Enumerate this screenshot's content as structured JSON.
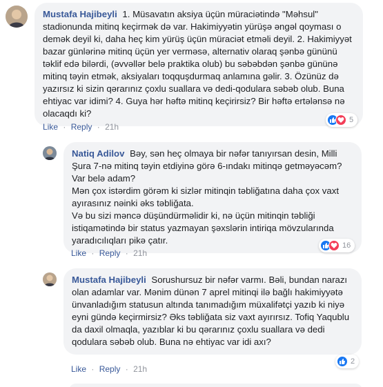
{
  "comments": [
    {
      "author": "Mustafa Hajibeyli",
      "text": "1. Müsavatın aksiya üçün müraciətində \"Məhsul\" stadionunda mitinq keçirmək də var. Hakimiyyətin yürüşə əngəl qoyması o demək deyil ki, daha heç kim yürüş üçün müraciət etməli deyil. 2. Hakimiyyət bazar günlərinə mitinq üçün yer verməsə, alternativ olaraq şənbə gününü təklif edə bilərdi, (əvvəllər belə praktika olub) bu səbəbdən şənbə gününə mitinq təyin etmək, aksiyaları toqquşdurmaq anlamına gəlir. 3. Özünüz də yazırsız ki sizin qərarınız çoxlu suallara və dedi-qodulara səbəb olub. Buna ehtiyac var idimi? 4. Guya hər həftə mitinq keçirirsiz? Bir həftə ertələnsə nə olacaqdı ki?",
      "like": "Like",
      "reply": "Reply",
      "time": "21h",
      "reaction_count": "5"
    },
    {
      "author": "Natiq Adilov",
      "text": "Bəy, sən heç olmaya bir nəfər tanıyırsan desin, Milli Şura 7-nə mitinq təyin etdiyinə görə 6-ındakı mitinqə getməyəcəm? Var belə adam?\nMən çox istərdim görəm ki sizlər mitinqin təbliğatına daha çox vaxt ayırasınız nəinki əks təbliğata.\nVə bu sizi məncə düşündürməlidir ki, nə üçün mitinqin təbliği istiqamətində bir status yazmayan şəxslərin intiriqa mövzularında yaradıcılıqları pikə çatır.",
      "like": "Like",
      "reply": "Reply",
      "time": "21h",
      "reaction_count": "16"
    },
    {
      "author": "Mustafa Hajibeyli",
      "text": "Sorushursuz bir nəfər varmı. Bəli, bundan narazı olan adamlar var. Mənim dünən 7 aprel mitinqi ilə bağlı hakimiyyətə ünvanladığım statusun altında tanımadığım müxalifətçi yazıb ki niyə eyni gündə keçirmirsiz? Əks təbliğata siz vaxt ayırırsız. Tofiq Yaqublu da daxil olmaqla, yazıblar ki bu qərarınız çoxlu suallara və dedi qodulara səbəb olub. Buna nə ehtiyac var idi axı?",
      "like": "Like",
      "reply": "Reply",
      "time": "21h",
      "reaction_count": "2"
    }
  ],
  "colors": {
    "author": "#385898",
    "bubble": "#f2f3f5",
    "meta": "#90949c",
    "like": "#1877f2",
    "love": "#f33e58"
  },
  "icons": [
    "like-reaction-icon",
    "love-reaction-icon"
  ]
}
